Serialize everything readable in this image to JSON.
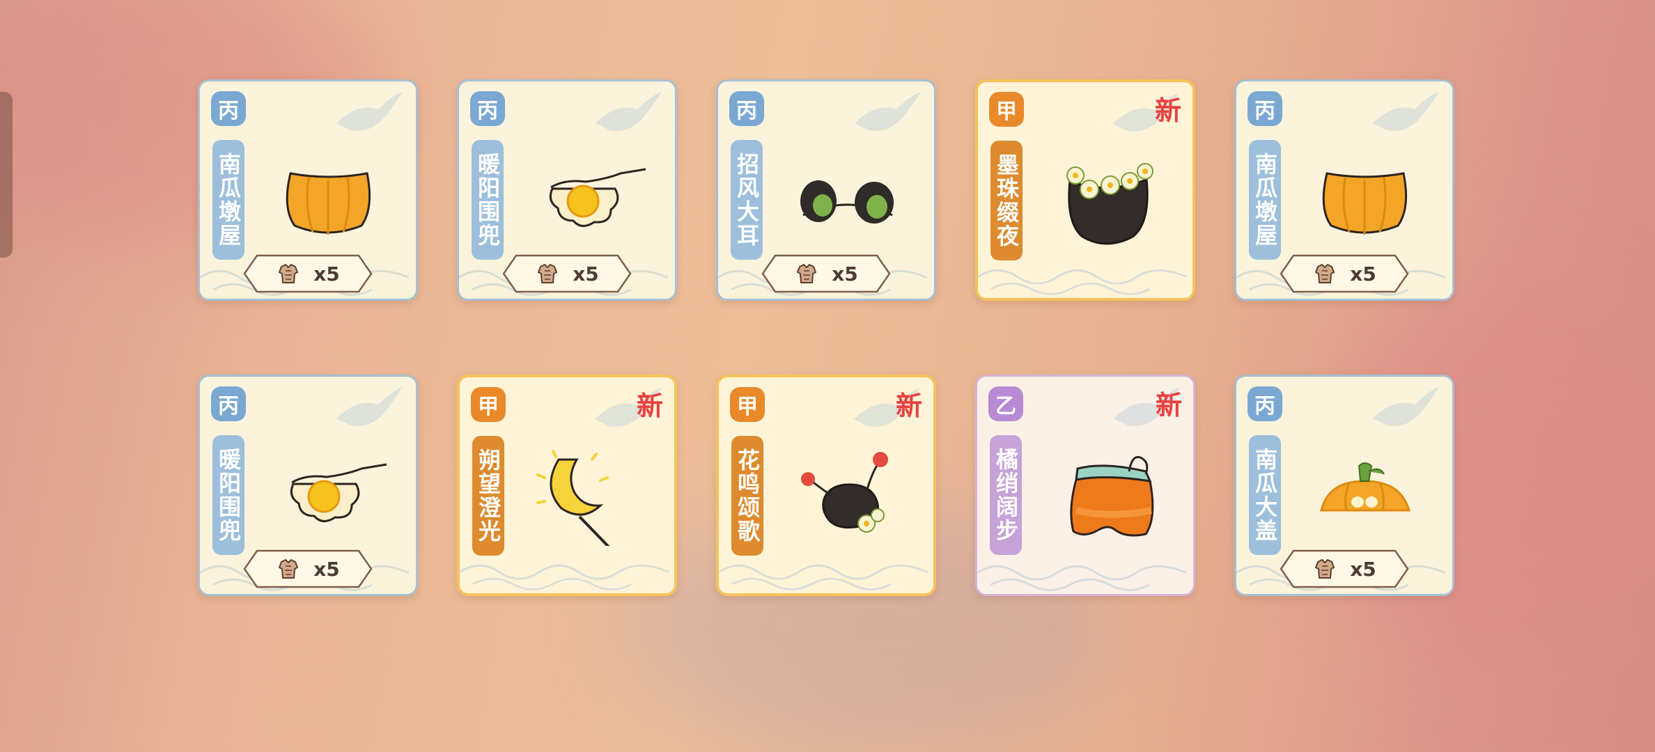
{
  "rarity_colors": {
    "丙": "#7aa8d2",
    "甲": "#e9892a",
    "乙": "#b88ad4"
  },
  "new_color": "#e9413f",
  "cards": [
    {
      "grade": "丙",
      "name": "南瓜墩屋",
      "cost_icon": "cloth-icon",
      "cost": "x5",
      "new": "",
      "item_icon": "pumpkin-skirt-icon"
    },
    {
      "grade": "丙",
      "name": "暖阳围兜",
      "cost_icon": "cloth-icon",
      "cost": "x5",
      "new": "",
      "item_icon": "sun-bib-icon"
    },
    {
      "grade": "丙",
      "name": "招风大耳",
      "cost_icon": "cloth-icon",
      "cost": "x5",
      "new": "",
      "item_icon": "big-ears-icon"
    },
    {
      "grade": "甲",
      "name": "墨珠缀夜",
      "cost_icon": "",
      "cost": "",
      "new": "新",
      "item_icon": "flower-collar-icon"
    },
    {
      "grade": "丙",
      "name": "南瓜墩屋",
      "cost_icon": "cloth-icon",
      "cost": "x5",
      "new": "",
      "item_icon": "pumpkin-skirt-icon"
    },
    {
      "grade": "丙",
      "name": "暖阳围兜",
      "cost_icon": "cloth-icon",
      "cost": "x5",
      "new": "",
      "item_icon": "sun-bib-icon"
    },
    {
      "grade": "甲",
      "name": "朔望澄光",
      "cost_icon": "",
      "cost": "",
      "new": "新",
      "item_icon": "moon-wand-icon"
    },
    {
      "grade": "甲",
      "name": "花鸣颂歌",
      "cost_icon": "",
      "cost": "",
      "new": "新",
      "item_icon": "cherry-hat-icon"
    },
    {
      "grade": "乙",
      "name": "橘绡阔步",
      "cost_icon": "",
      "cost": "",
      "new": "新",
      "item_icon": "orange-shorts-icon"
    },
    {
      "grade": "丙",
      "name": "南瓜大盖",
      "cost_icon": "cloth-icon",
      "cost": "x5",
      "new": "",
      "item_icon": "pumpkin-hat-icon"
    }
  ]
}
